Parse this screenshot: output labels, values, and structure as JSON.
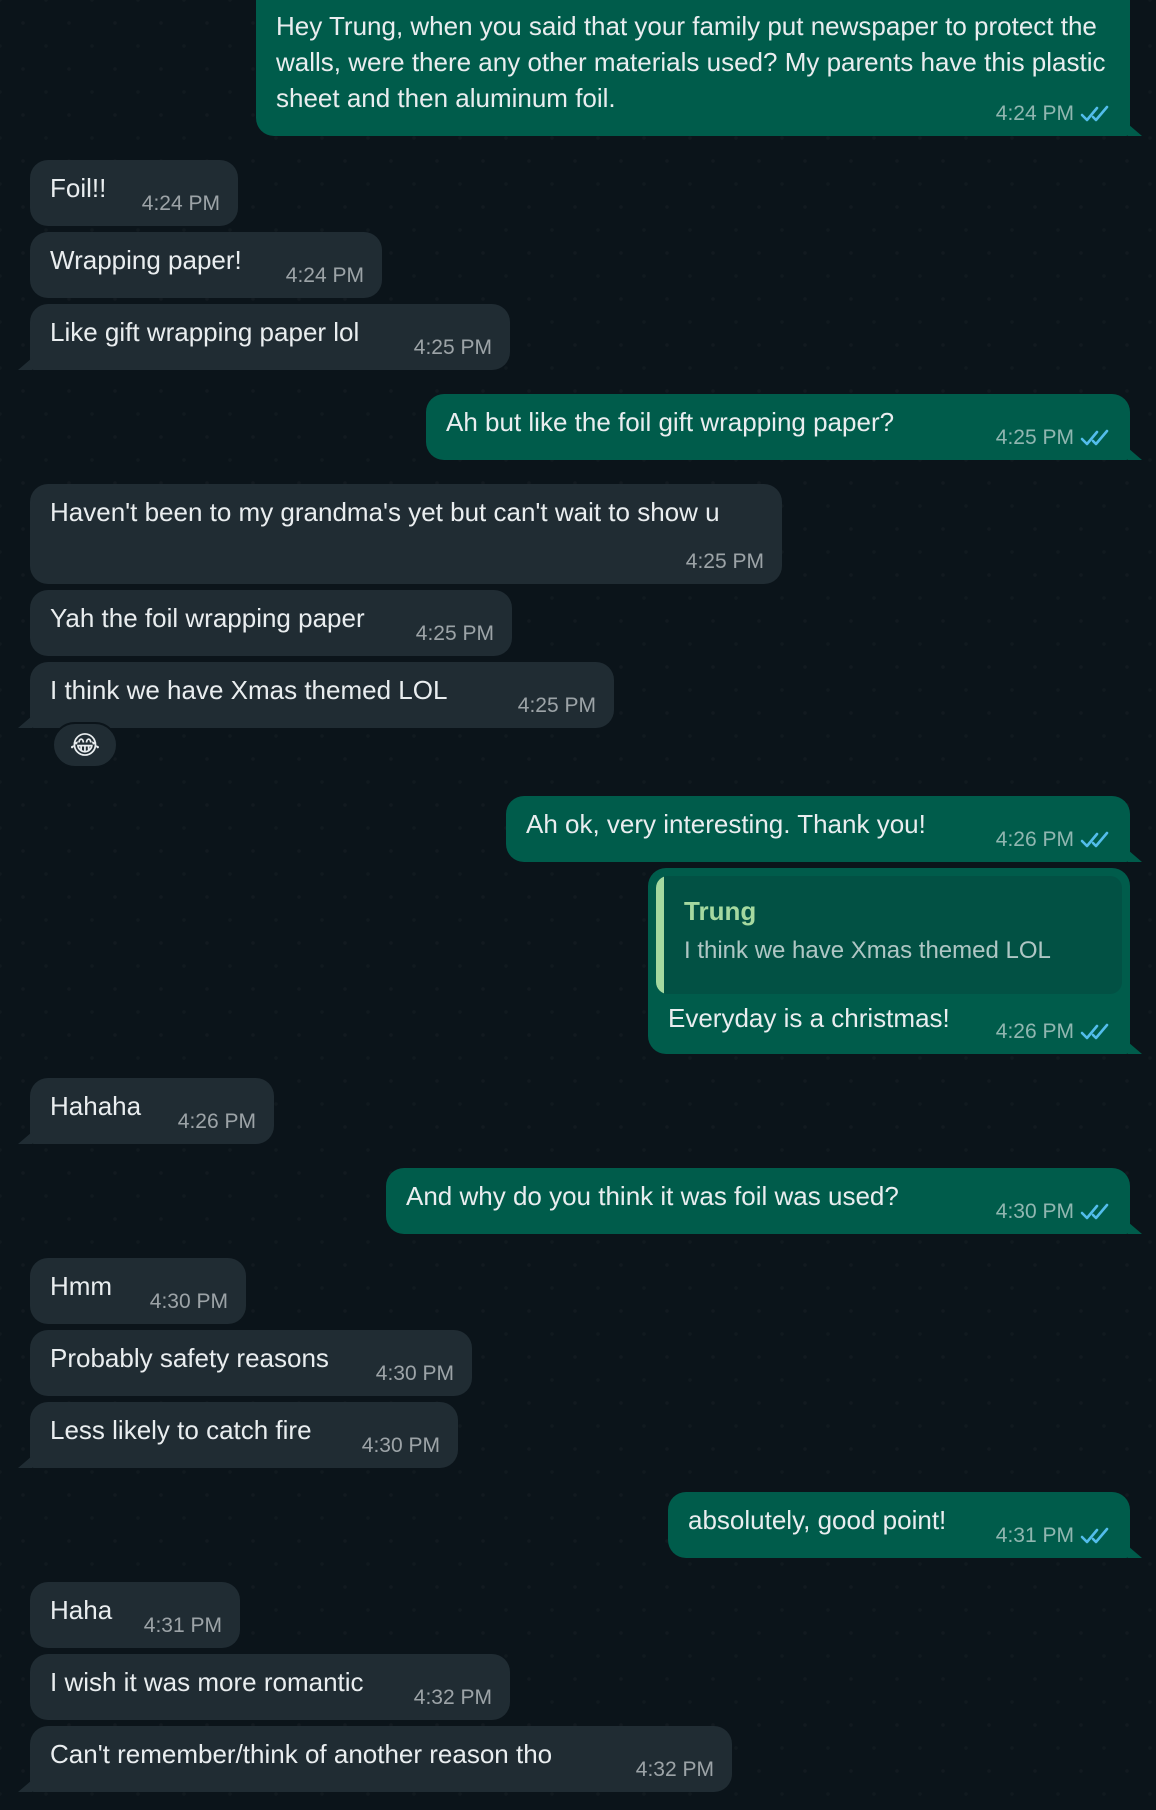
{
  "colors": {
    "background": "#0b141a",
    "incoming_bubble": "#202c33",
    "outgoing_bubble": "#005c4b",
    "read_ticks": "#53bdeb",
    "quote_accent": "#a5d9a0"
  },
  "messages": [
    {
      "direction": "out",
      "text": "Hey Trung, when you said that your family put newspaper to protect the walls, were there any other materials used? My parents have this plastic sheet and then aluminum foil.",
      "time": "4:24 PM",
      "status": "read"
    },
    {
      "direction": "in",
      "text": "Foil!!",
      "time": "4:24 PM"
    },
    {
      "direction": "in",
      "text": "Wrapping paper!",
      "time": "4:24 PM"
    },
    {
      "direction": "in",
      "text": "Like gift wrapping paper lol",
      "time": "4:25 PM"
    },
    {
      "direction": "out",
      "text": "Ah but like the foil gift wrapping paper?",
      "time": "4:25 PM",
      "status": "read"
    },
    {
      "direction": "in",
      "text": "Haven't been to my grandma's yet but can't wait to show u",
      "time": "4:25 PM"
    },
    {
      "direction": "in",
      "text": "Yah the foil wrapping paper",
      "time": "4:25 PM"
    },
    {
      "direction": "in",
      "text": "I think we have Xmas themed LOL",
      "time": "4:25 PM",
      "reaction": "😂"
    },
    {
      "direction": "out",
      "text": "Ah ok, very interesting. Thank you!",
      "time": "4:26 PM",
      "status": "read"
    },
    {
      "direction": "out",
      "text": "Everyday is a christmas!",
      "time": "4:26 PM",
      "status": "read",
      "quoted": {
        "author": "Trung",
        "text": "I think we have Xmas themed LOL"
      }
    },
    {
      "direction": "in",
      "text": "Hahaha",
      "time": "4:26 PM"
    },
    {
      "direction": "out",
      "text": "And why do you think it was foil was used?",
      "time": "4:30 PM",
      "status": "read"
    },
    {
      "direction": "in",
      "text": "Hmm",
      "time": "4:30 PM"
    },
    {
      "direction": "in",
      "text": "Probably safety reasons",
      "time": "4:30 PM"
    },
    {
      "direction": "in",
      "text": "Less likely to catch fire",
      "time": "4:30 PM"
    },
    {
      "direction": "out",
      "text": "absolutely, good point!",
      "time": "4:31 PM",
      "status": "read"
    },
    {
      "direction": "in",
      "text": "Haha",
      "time": "4:31 PM"
    },
    {
      "direction": "in",
      "text": "I wish it was more romantic",
      "time": "4:32 PM"
    },
    {
      "direction": "in",
      "text": "Can't remember/think of another reason tho",
      "time": "4:32 PM"
    }
  ]
}
